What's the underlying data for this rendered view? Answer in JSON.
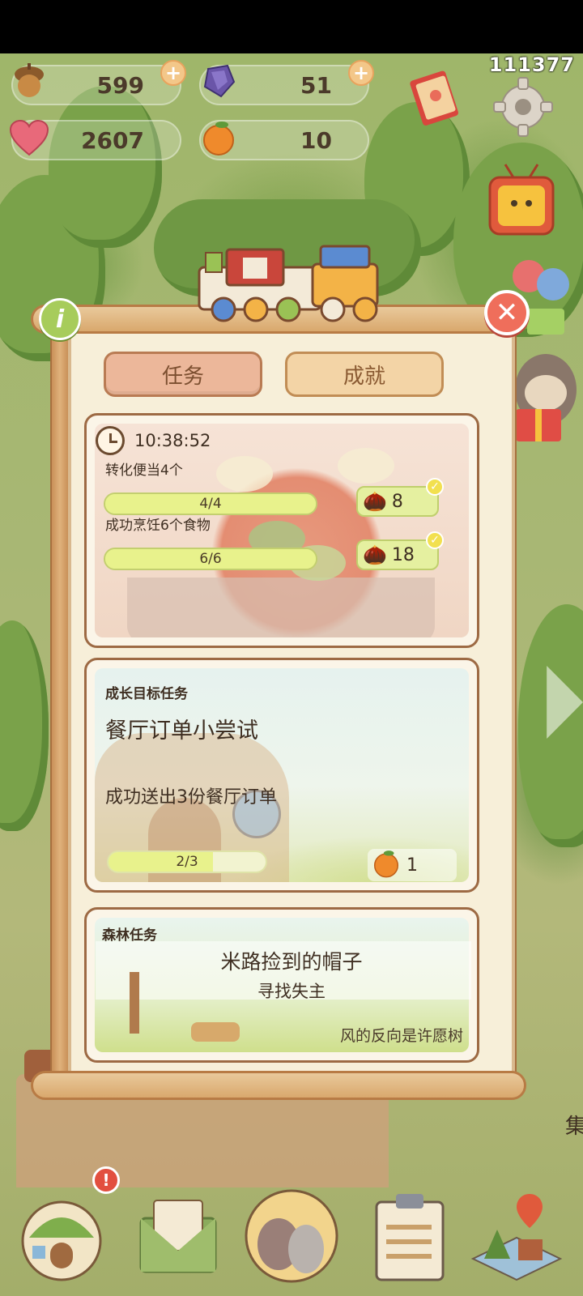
{
  "resources": {
    "acorns": "599",
    "gems": "51",
    "hearts": "2607",
    "oranges": "10"
  },
  "build_number": "111377",
  "tabs": {
    "tasks": "任务",
    "achievements": "成就"
  },
  "daily": {
    "timer": "10:38:52",
    "tasks": [
      {
        "label": "转化便当4个",
        "progress": "4/4",
        "progress_fraction": 1.0,
        "reward": "8",
        "completed": true
      },
      {
        "label": "成功烹饪6个食物",
        "progress": "6/6",
        "progress_fraction": 1.0,
        "reward": "18",
        "completed": true
      }
    ]
  },
  "growth": {
    "header": "成长目标任务",
    "title": "餐厅订单小尝试",
    "description": "成功送出3份餐厅订单",
    "progress": "2/3",
    "progress_fraction": 0.667,
    "reward": "1"
  },
  "forest": {
    "header": "森林任务",
    "title": "米路捡到的帽子",
    "subtitle": "寻找失主",
    "hint": "风的反向是许愿树"
  },
  "edge_text": "集",
  "colors": {
    "tab_active": "#ecb79a",
    "tab_inactive": "#f3d4a6",
    "progress_fill": "#e8f28c",
    "close_button": "#ef6e5b",
    "info_button": "#a7cc5b",
    "panel": "#f7efd9"
  },
  "icons": {
    "acorn": "acorn-icon",
    "gem": "purple-gem-icon",
    "heart": "heart-icon",
    "orange": "orange-icon",
    "clock": "clock-icon",
    "close": "close-icon",
    "info": "info-icon",
    "settings": "gear-icon"
  }
}
